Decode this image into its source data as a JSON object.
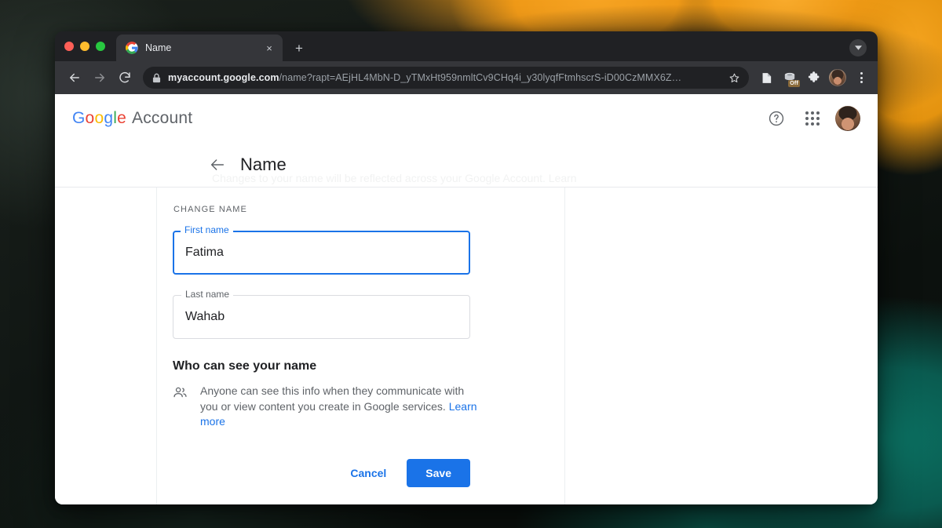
{
  "browser": {
    "traffic_lights": [
      "close",
      "minimize",
      "maximize"
    ],
    "tab": {
      "title": "Name",
      "favicon": "google-g-icon",
      "close_label": "×"
    },
    "new_tab_label": "+",
    "toolbar": {
      "back_icon": "arrow-left-icon",
      "forward_icon": "arrow-right-icon",
      "reload_icon": "reload-icon",
      "lock_icon": "lock-icon",
      "url_host": "myaccount.google.com",
      "url_path": "/name?rapt=AEjHL4MbN-D_yTMxHt959nmltCv9CHq4i_y30lyqfFtmhscrS-iD00CzMMX6Z…",
      "bookmark_icon": "star-icon",
      "reading_list_icon": "bookmark-tag-icon",
      "extension_badge": "Off",
      "extensions_icon": "puzzle-piece-icon",
      "profile_icon": "profile-avatar",
      "menu_icon": "three-dot-menu-icon"
    }
  },
  "page": {
    "ghost_text": "Changes to your name will be reflected across your Google Account. Learn more",
    "brand": {
      "google": "Google",
      "letters": [
        "G",
        "o",
        "o",
        "g",
        "l",
        "e"
      ],
      "product": "Account"
    },
    "header_actions": {
      "help_icon": "help-circle-icon",
      "apps_icon": "apps-grid-icon",
      "avatar": "account-avatar"
    },
    "title": "Name",
    "back_icon": "arrow-left-icon",
    "section_label": "CHANGE NAME",
    "fields": [
      {
        "name": "first-name",
        "label": "First name",
        "value": "Fatima",
        "focused": true
      },
      {
        "name": "last-name",
        "label": "Last name",
        "value": "Wahab",
        "focused": false
      }
    ],
    "visibility": {
      "heading": "Who can see your name",
      "icon": "people-icon",
      "text": "Anyone can see this info when they communicate with you or view content you create in Google services. ",
      "link": "Learn more"
    },
    "actions": {
      "cancel": "Cancel",
      "save": "Save"
    }
  },
  "colors": {
    "accent": "#1a73e8",
    "text_primary": "#202124",
    "text_secondary": "#5f6368",
    "border": "#dadce0",
    "chrome_dark": "#202124",
    "toolbar_dark": "#35363a"
  }
}
